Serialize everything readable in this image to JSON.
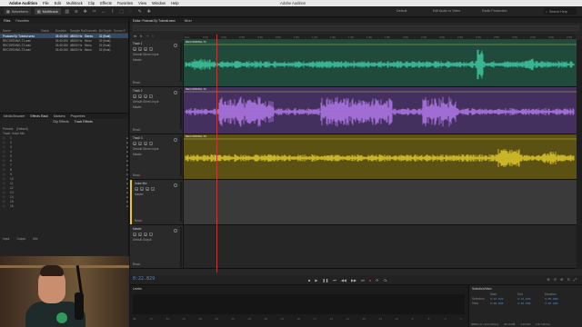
{
  "menubar": {
    "app": "Adobe Audition",
    "items": [
      "File",
      "Edit",
      "Multitrack",
      "Clip",
      "Effects",
      "Favorites",
      "View",
      "Window",
      "Help"
    ],
    "window_title": "Adobe Audition"
  },
  "toolbar": {
    "waveform": "Waveform",
    "multitrack": "Multitrack",
    "workspaces": [
      "Default",
      "Edit Audio to Video",
      "Radio Production"
    ],
    "search_placeholder": "Search Help"
  },
  "files_panel": {
    "tabs": [
      "Files",
      "Favorites"
    ],
    "columns": [
      "Name",
      "Status",
      "Duration",
      "Sample Rate",
      "Channels",
      "Bit Depth",
      "Source F"
    ],
    "rows": [
      [
        "Podcast Ep Tutorial.sesx",
        "",
        "03:40.000",
        "48000 Hz",
        "Stereo",
        "32 (float)",
        ""
      ],
      [
        "RECORDING-T1.wav",
        "",
        "03:40.000",
        "48000 Hz",
        "Mono",
        "32 (float)",
        ""
      ],
      [
        "RECORDING-T2.wav",
        "",
        "03:40.000",
        "48000 Hz",
        "Mono",
        "32 (float)",
        ""
      ],
      [
        "RECORDING-T3.wav",
        "",
        "03:40.000",
        "48000 Hz",
        "Mono",
        "32 (float)",
        ""
      ]
    ]
  },
  "effects_panel": {
    "tabs": [
      "Media Browser",
      "Effects Rack",
      "Markers",
      "Properties"
    ],
    "sub_tabs": [
      "Clip Effects",
      "Track Effects"
    ],
    "presets_label": "Presets:",
    "preset_value": "(Default)",
    "master_label": "Track: Voice Mix",
    "slots": [
      "1",
      "2",
      "3",
      "4",
      "5",
      "6",
      "7",
      "8",
      "9",
      "10",
      "11",
      "12",
      "13",
      "14",
      "15",
      "16"
    ],
    "input_label": "Input",
    "output_label": "Output",
    "mix_label": "Mix"
  },
  "editor": {
    "tabs": [
      "Editor: Podcast Ep Tutorial.sesx",
      "Mixer"
    ],
    "ruler_labels": [
      "hms",
      "0:10",
      "0:20",
      "0:30",
      "0:40",
      "0:50",
      "1:00",
      "1:10",
      "1:20",
      "1:30",
      "1:40",
      "1:50",
      "2:00",
      "2:10",
      "2:20",
      "2:30",
      "2:40",
      "2:50",
      "3:00",
      "3:10",
      "3:20",
      "3:30"
    ],
    "tracks": [
      {
        "name": "Track 1",
        "input": "Default Stereo Input",
        "mode": "Read",
        "out": "Master",
        "clip": "RECORDING-T1",
        "color": "#1f4a3c",
        "wave": "#3fd0a6"
      },
      {
        "name": "Track 2",
        "input": "Default Stereo Input",
        "mode": "Read",
        "out": "Master",
        "clip": "RECORDING-T2",
        "color": "#44305e",
        "wave": "#b77df0"
      },
      {
        "name": "Track 3",
        "input": "Default Stereo Input",
        "mode": "Read",
        "out": "Master",
        "clip": "RECORDING-T3",
        "color": "#5a5112",
        "wave": "#e6cf2f"
      },
      {
        "name": "Voice Mix",
        "input": "",
        "mode": "Read",
        "out": "Master",
        "clip": "",
        "color": "#3a3a3a",
        "wave": ""
      },
      {
        "name": "Master",
        "input": "",
        "mode": "Read",
        "out": "Default Output",
        "clip": "",
        "color": "#262626",
        "wave": ""
      }
    ]
  },
  "transport": {
    "timecode": "0:22.829"
  },
  "levels": {
    "title": "Levels",
    "scale": [
      "dB",
      "-57",
      "-54",
      "-51",
      "-48",
      "-45",
      "-42",
      "-39",
      "-36",
      "-33",
      "-30",
      "-27",
      "-24",
      "-21",
      "-18",
      "-15",
      "-12",
      "-9",
      "-6",
      "-3",
      "0"
    ]
  },
  "selection_view": {
    "title": "Selection/View",
    "headers": [
      "",
      "Start",
      "End",
      "Duration"
    ],
    "rows": [
      [
        "Selection",
        "0:22.829",
        "0:22.829",
        "0:00.000"
      ],
      [
        "View",
        "0:00.000",
        "3:40.000",
        "3:40.000"
      ]
    ]
  },
  "statusbar": {
    "items": [
      "48000 Hz • 32-bit Mixing",
      "84.13 MB",
      "3:40.000",
      "2.57 GB free"
    ]
  },
  "colors": {
    "track1": "#3fd0a6",
    "track2": "#b77df0",
    "track3": "#e6cf2f",
    "playhead": "#c03a3a",
    "timecode": "#4f8dd6"
  }
}
